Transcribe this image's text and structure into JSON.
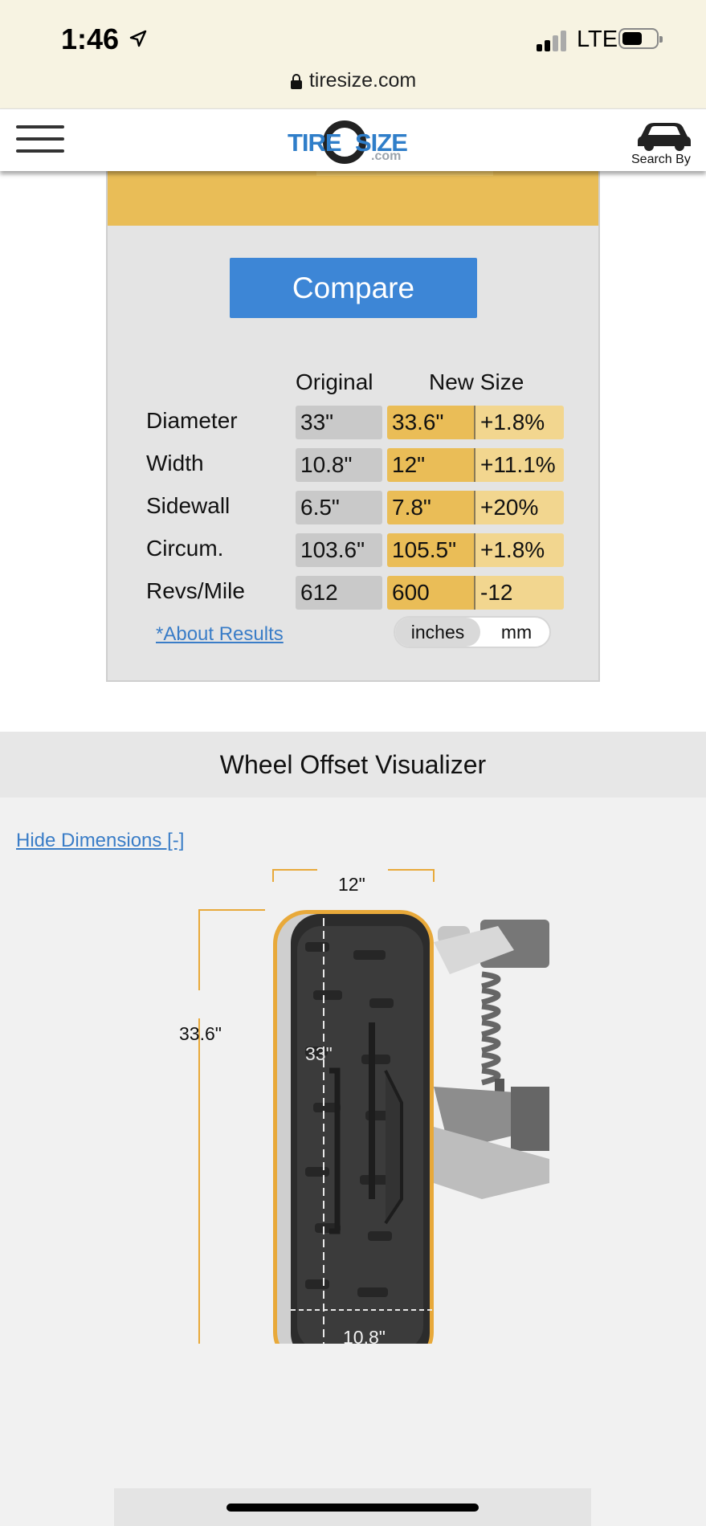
{
  "status_bar": {
    "time": "1:46",
    "network": "LTE",
    "url": "tiresize.com"
  },
  "header": {
    "logo_tire": "TIRE",
    "logo_size": "SIZE",
    "logo_com": ".com",
    "search_by_label": "Search By"
  },
  "compare": {
    "button_label": "Compare",
    "col_original": "Original",
    "col_new": "New Size",
    "rows": [
      {
        "label": "Diameter",
        "original": "33\"",
        "new": "33.6\"",
        "diff": "+1.8%"
      },
      {
        "label": "Width",
        "original": "10.8\"",
        "new": "12\"",
        "diff": "+11.1%"
      },
      {
        "label": "Sidewall",
        "original": "6.5\"",
        "new": "7.8\"",
        "diff": "+20%"
      },
      {
        "label": "Circum.",
        "original": "103.6\"",
        "new": "105.5\"",
        "diff": "+1.8%"
      },
      {
        "label": "Revs/Mile",
        "original": "612",
        "new": "600",
        "diff": "-12"
      }
    ],
    "about_link": "*About Results",
    "unit_inches": "inches",
    "unit_mm": "mm",
    "unit_selected": "inches"
  },
  "visualizer": {
    "title": "Wheel Offset Visualizer",
    "hide_link": "Hide Dimensions [-]",
    "new_width": "12\"",
    "new_diameter": "33.6\"",
    "orig_diameter": "33\"",
    "orig_width": "10.8\""
  },
  "colors": {
    "accent_blue": "#3d86d6",
    "new_size_orange": "#eabd57",
    "original_gray": "#c9c9c9",
    "link_blue": "#3a7dc7"
  }
}
